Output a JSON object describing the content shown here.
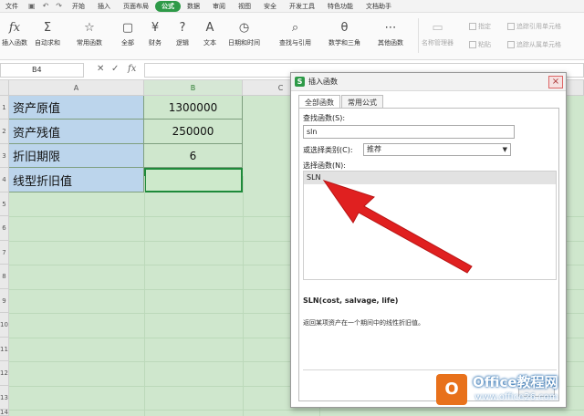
{
  "menubar": {
    "file": "文件",
    "tabs": [
      "开始",
      "插入",
      "页面布局",
      "公式",
      "数据",
      "审阅",
      "视图",
      "安全",
      "开发工具",
      "特色功能",
      "文档助手"
    ],
    "active_tab": "公式"
  },
  "ribbon": {
    "insert_function": "插入函数",
    "autosum": "自动求和",
    "common_functions": "常用函数",
    "all": "全部",
    "finance": "财务",
    "logic": "逻辑",
    "text": "文本",
    "datetime": "日期和时间",
    "lookup": "查找与引用",
    "math": "数学和三角",
    "other": "其他函数",
    "name_manager": "名称管理器",
    "define": "指定",
    "paste": "粘贴",
    "trace_precedents": "追踪引用单元格",
    "trace_dependents": "追踪从属单元格"
  },
  "formula_bar": {
    "name_box": "B4",
    "fx": "fx"
  },
  "sheet": {
    "columns": [
      "A",
      "B",
      "C"
    ],
    "rows": [
      "1",
      "2",
      "3",
      "4",
      "5",
      "6",
      "7",
      "8",
      "9",
      "10",
      "11",
      "12",
      "13",
      "14"
    ],
    "cells": [
      {
        "label": "资产原值",
        "value": "1300000"
      },
      {
        "label": "资产残值",
        "value": "250000"
      },
      {
        "label": "折旧期限",
        "value": "6"
      },
      {
        "label": "线型折旧值",
        "value": ""
      }
    ]
  },
  "dialog": {
    "title": "插入函数",
    "tab_all": "全部函数",
    "tab_common": "常用公式",
    "search_label": "查找函数(S):",
    "search_value": "sln",
    "category_label": "或选择类别(C):",
    "category_value": "推荐",
    "select_label": "选择函数(N):",
    "functions": [
      "SLN"
    ],
    "signature": "SLN(cost, salvage, life)",
    "description": "返回某项资产在一个期间中的线性折旧值。"
  },
  "watermark": {
    "brand": "Office教程网",
    "url": "www.office26.com"
  },
  "colors": {
    "accent": "#2e9a48",
    "label_fill": "#bcd5ec",
    "sheet_fill": "#cfe7cd",
    "arrow": "#e02020"
  }
}
